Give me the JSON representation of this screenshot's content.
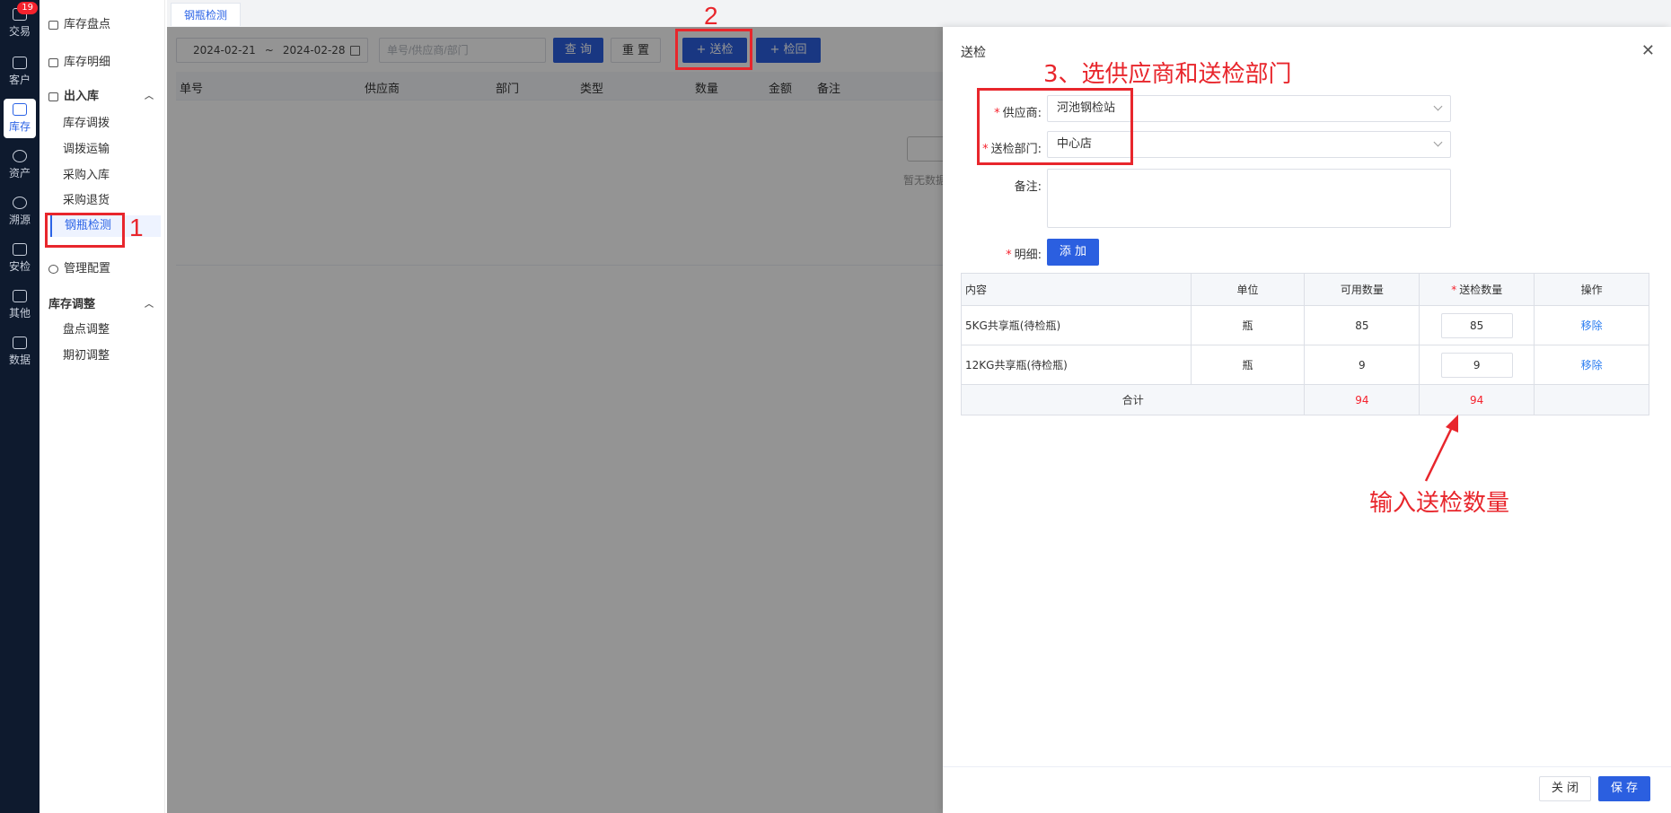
{
  "rail": {
    "items": [
      {
        "label": "交易",
        "badge": "19",
        "icon": "trade-icon"
      },
      {
        "label": "客户",
        "icon": "customer-icon"
      },
      {
        "label": "库存",
        "icon": "inventory-icon",
        "active": true
      },
      {
        "label": "资产",
        "icon": "asset-icon"
      },
      {
        "label": "溯源",
        "icon": "trace-icon"
      },
      {
        "label": "安检",
        "icon": "safety-icon"
      },
      {
        "label": "其他",
        "icon": "other-icon"
      },
      {
        "label": "数据",
        "icon": "data-icon"
      }
    ]
  },
  "sidebar": {
    "stocktake": "库存盘点",
    "detail": "库存明细",
    "inout": "出入库",
    "transfer": "库存调拨",
    "transport": "调拨运输",
    "purchase_in": "采购入库",
    "purchase_return": "采购退货",
    "cylinder_check": "钢瓶检测",
    "config": "管理配置",
    "adjust": "库存调整",
    "count_adjust": "盘点调整",
    "initial_adjust": "期初调整"
  },
  "tab": {
    "label": "钢瓶检测"
  },
  "filter": {
    "date_start": "2024-02-21",
    "date_sep": "~",
    "date_end": "2024-02-28",
    "search_placeholder": "单号/供应商/部门",
    "query_label": "查 询",
    "reset_label": "重 置",
    "send_label": "+ 送检",
    "return_label": "+ 检回"
  },
  "grid": {
    "columns": [
      "单号",
      "供应商",
      "部门",
      "类型",
      "数量",
      "金额",
      "备注"
    ],
    "empty_text": "暂无数据"
  },
  "annotations": {
    "step1": "1",
    "step2": "2",
    "step3": "3、选供应商和送检部门",
    "hint": "输入送检数量"
  },
  "drawer": {
    "title": "送检",
    "supplier_label": "供应商:",
    "supplier_value": "河池钢检站",
    "dept_label": "送检部门:",
    "dept_value": "中心店",
    "remark_label": "备注:",
    "detail_label": "明细:",
    "add_label": "添 加",
    "table": {
      "headers": [
        "内容",
        "单位",
        "可用数量",
        "送检数量",
        "操作"
      ],
      "rows": [
        {
          "content": "5KG共享瓶(待检瓶)",
          "unit": "瓶",
          "available": "85",
          "qty": "85",
          "action": "移除"
        },
        {
          "content": "12KG共享瓶(待检瓶)",
          "unit": "瓶",
          "available": "9",
          "qty": "9",
          "action": "移除"
        }
      ],
      "total_label": "合计",
      "total_available": "94",
      "total_qty": "94"
    },
    "close_label": "关 闭",
    "save_label": "保 存"
  },
  "colors": {
    "accent": "#2b5fe0",
    "annotation": "#e8262c",
    "rail_bg": "#0e1a2e"
  }
}
